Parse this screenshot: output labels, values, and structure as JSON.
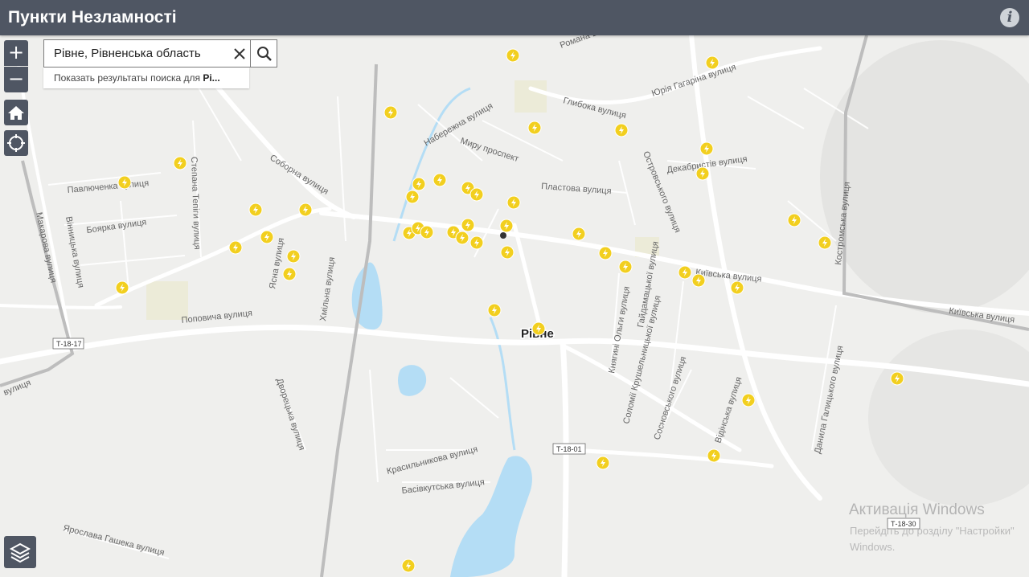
{
  "header": {
    "title": "Пункти Незламності",
    "info_icon": "info-icon"
  },
  "search": {
    "value": "Рівне, Рівненська область",
    "suggestion_prefix": "Показать результаты поиска для ",
    "suggestion_term": "Рі..."
  },
  "controls": {
    "zoom_in": "+",
    "zoom_out": "−"
  },
  "map": {
    "city_label": "Рівне",
    "streets": [
      "Романа Ш",
      "Юрія Гагаріна вулиця",
      "Набережна вулиця",
      "Глибока вулиця",
      "Миру проспект",
      "Островського вулиця",
      "Декабристів вулиця",
      "Пластова вулиця",
      "Соборна вулиця",
      "Павлюченка вулиця",
      "Боярка вулиця",
      "Вінницька вулиця",
      "Макарова вулиця",
      "Степана Тепіги вулиця",
      "Хмільна вулиця",
      "Ясна вулиця",
      "Поповича вулиця",
      "Київська вулиця",
      "Костромська вулиця",
      "Княгині Ольги вулиця",
      "Гайдамацької вулиця",
      "Соломії Крушельницької вулиця",
      "Сосновського вулиця",
      "Відінська вулиця",
      "Данила Галицького вулиця",
      "Дворецька вулиця",
      "Красильникова вулиця",
      "Басівкутська вулиця",
      "Ярослава Гашека вулиця",
      "вулиця"
    ],
    "road_shields": [
      "Т-18-17",
      "Т-18-01",
      "Т-18-30"
    ],
    "markers_icon": "lightning-icon",
    "marker_color": "#f2cf1f"
  },
  "watermark": {
    "title": "Активація Windows",
    "line1": "Перейдіть до розділу \"Настройки\"",
    "line2": "Windows."
  }
}
